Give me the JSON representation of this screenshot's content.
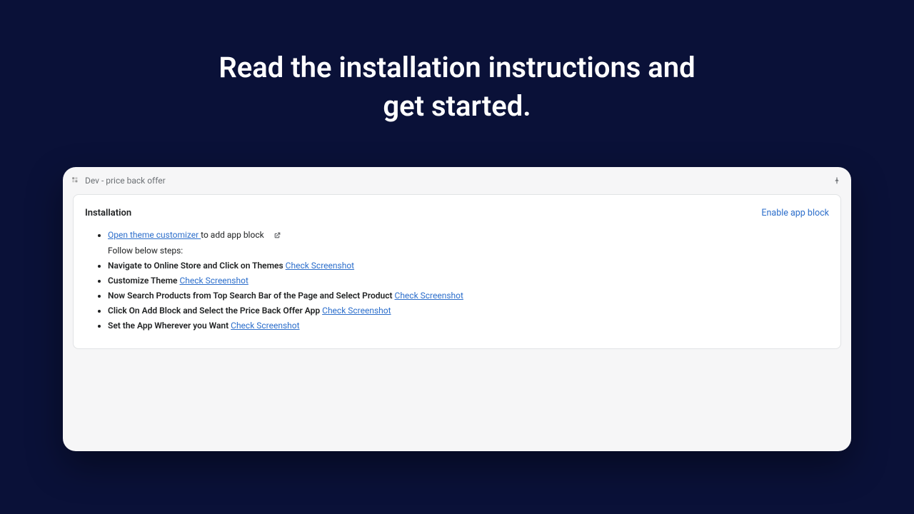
{
  "heading": {
    "line1": "Read the installation instructions and",
    "line2": "get started."
  },
  "titleBar": {
    "text": "Dev - price back offer"
  },
  "card": {
    "title": "Installation",
    "actionLabel": "Enable app block"
  },
  "list": {
    "item1": {
      "linkText": "Open theme customizer ",
      "afterText": "to add app block",
      "subText": "Follow below steps:"
    },
    "item2": {
      "boldText": "Navigate to Online Store and Click on Themes",
      "linkText": "Check Screenshot"
    },
    "item3": {
      "boldText": "Customize Theme",
      "linkText": "Check Screenshot"
    },
    "item4": {
      "boldText": "Now Search Products from Top Search Bar of the Page and Select Product",
      "linkText": "Check Screenshot"
    },
    "item5": {
      "boldText": "Click On Add Block and Select the Price Back Offer App",
      "linkText": "Check Screenshot"
    },
    "item6": {
      "boldText": "Set the App Wherever you Want",
      "linkText": "Check Screenshot"
    }
  }
}
